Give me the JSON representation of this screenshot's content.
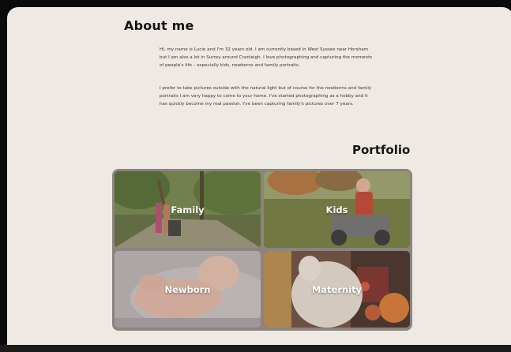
{
  "about": {
    "title": "About me",
    "paragraph_1": "Hi, my name is Lucie and I'm 32 years old. I am currently based in West Sussex near Horsham but I am also a lot in Surrey around Cranleigh. I love photographing and capturing the moments of people's life – especially kids, newborns and family portraits.",
    "paragraph_2": "I prefer to take pictures outside with the natural light but of course for the newborns and family portraits I am very happy to come to your home. I've started photographing as a hobby and it has quickly become my real passion. I've been capturing family's pictures over 7 years."
  },
  "portfolio": {
    "title": "Portfolio",
    "tiles": [
      {
        "label": "Family"
      },
      {
        "label": "Kids"
      },
      {
        "label": "Newborn"
      },
      {
        "label": "Maternity"
      }
    ]
  },
  "colors": {
    "page_background": "#efe9e4",
    "outer_background": "#0b0b0b",
    "grid_frame": "#8c847e",
    "text_dark": "#141414"
  }
}
